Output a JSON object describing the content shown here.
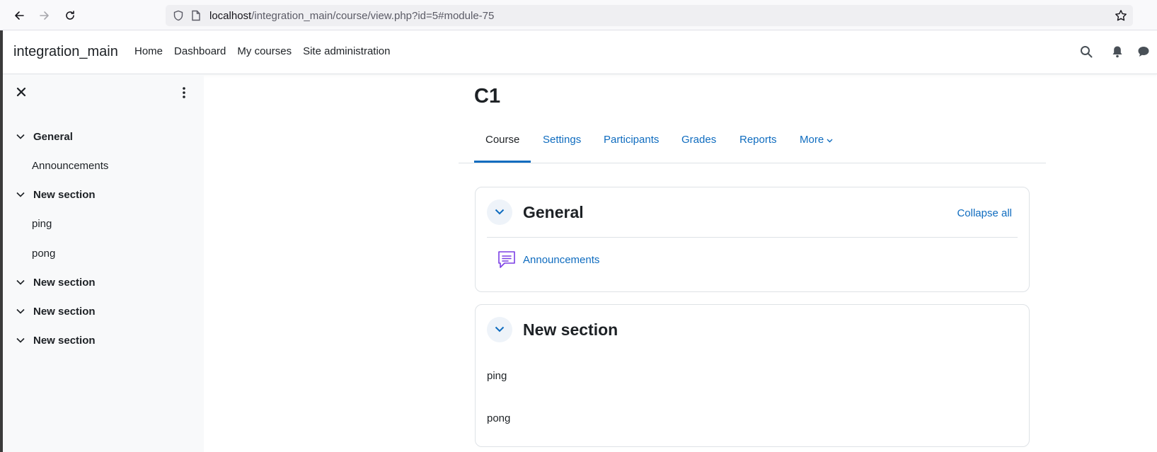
{
  "browser": {
    "url_host": "localhost",
    "url_path": "/integration_main/course/view.php?id=5#module-75"
  },
  "navbar": {
    "brand": "integration_main",
    "links": [
      "Home",
      "Dashboard",
      "My courses",
      "Site administration"
    ]
  },
  "drawer": {
    "items": [
      {
        "type": "section",
        "label": "General"
      },
      {
        "type": "activity",
        "label": "Announcements"
      },
      {
        "type": "section",
        "label": "New section"
      },
      {
        "type": "activity",
        "label": "ping"
      },
      {
        "type": "activity",
        "label": "pong"
      },
      {
        "type": "section",
        "label": "New section"
      },
      {
        "type": "section",
        "label": "New section"
      },
      {
        "type": "section",
        "label": "New section"
      }
    ]
  },
  "course": {
    "title": "C1",
    "tabs": [
      "Course",
      "Settings",
      "Participants",
      "Grades",
      "Reports",
      "More"
    ],
    "active_tab": "Course"
  },
  "sections": [
    {
      "title": "General",
      "collapse_all_label": "Collapse all",
      "activities": [
        {
          "label": "Announcements",
          "icon": "forum-icon"
        }
      ]
    },
    {
      "title": "New section",
      "activities": [
        {
          "label": "ping"
        },
        {
          "label": "pong"
        }
      ]
    }
  ],
  "colors": {
    "link": "#0f6cbf",
    "text": "#1d2125",
    "drawer_bg": "#f8f9fa",
    "forum_icon": "#7b3fe4"
  }
}
